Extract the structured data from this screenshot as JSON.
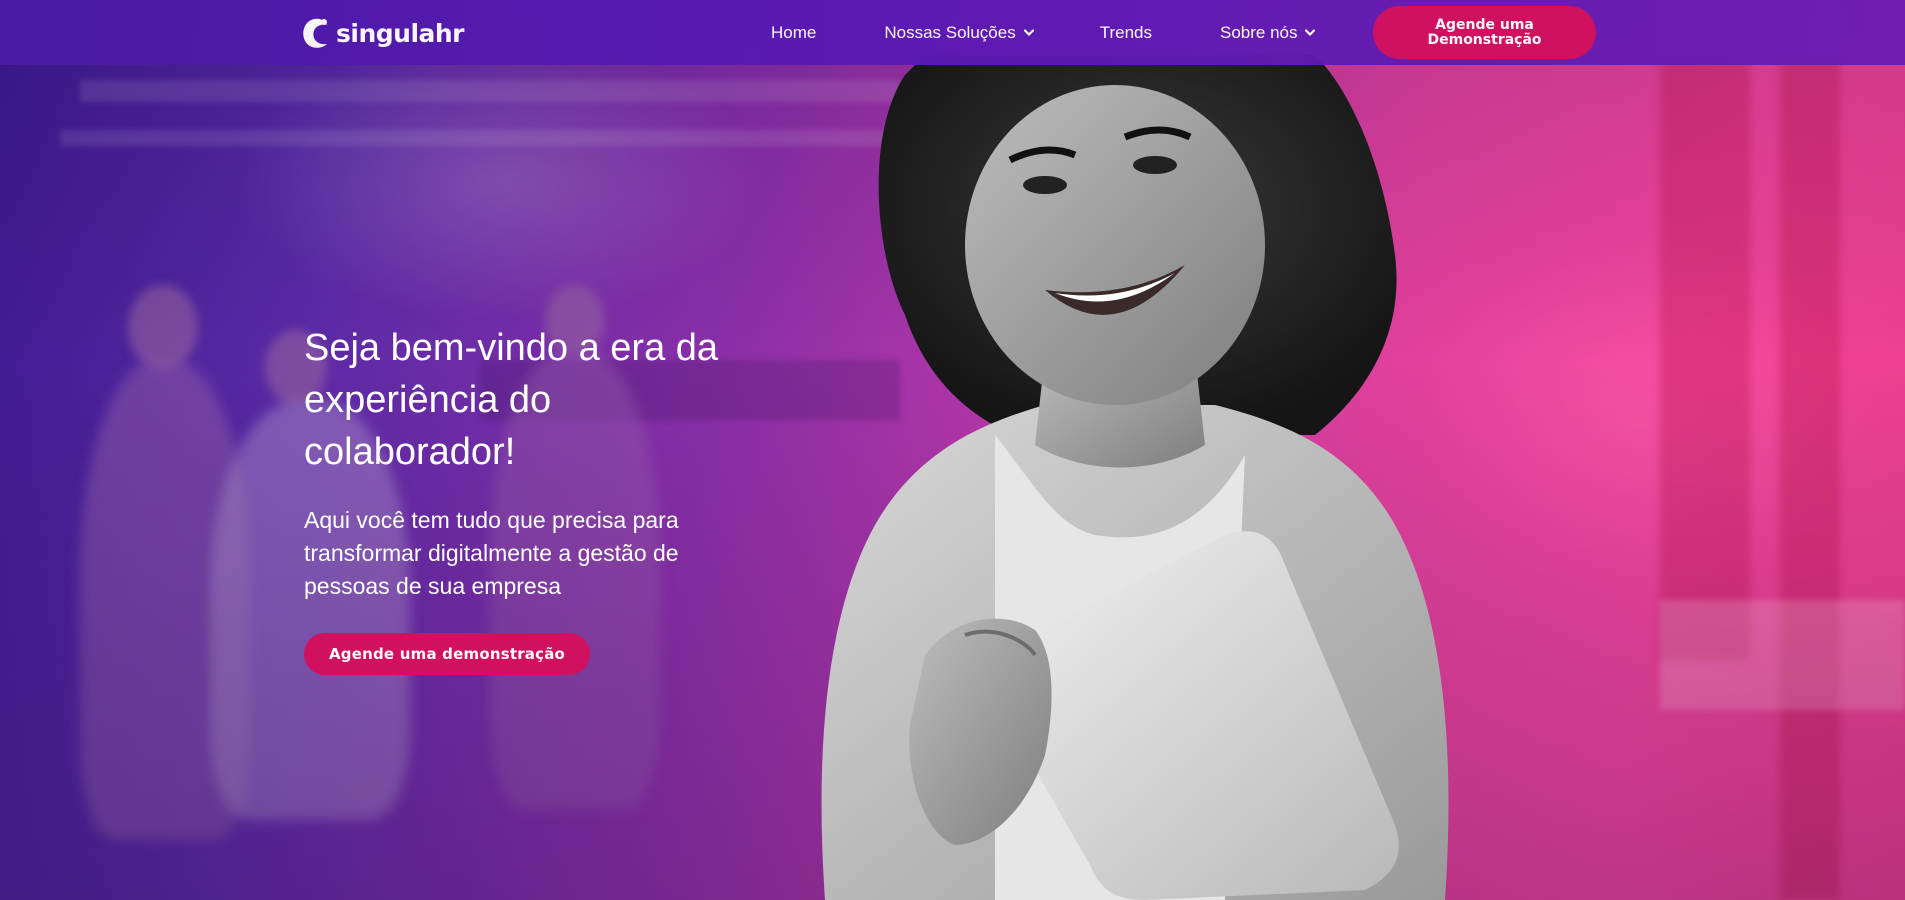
{
  "brand": {
    "name": "singulahr",
    "logo_icon": "crescent-c-logo",
    "primary_color": "#5c1ab5",
    "accent_color": "#d1105f"
  },
  "nav": {
    "items": [
      {
        "label": "Home",
        "has_dropdown": false
      },
      {
        "label": "Nossas Soluções",
        "has_dropdown": true
      },
      {
        "label": "Trends",
        "has_dropdown": false
      },
      {
        "label": "Sobre nós",
        "has_dropdown": true
      }
    ],
    "cta_label": "Agende uma Demonstração"
  },
  "hero": {
    "headline": "Seja bem-vindo a era da experiência do colaborador!",
    "subheadline": "Aqui você tem tudo que precisa para transformar digitalmente a gestão de pessoas de sua empresa",
    "cta_label": "Agende uma demonstração"
  }
}
